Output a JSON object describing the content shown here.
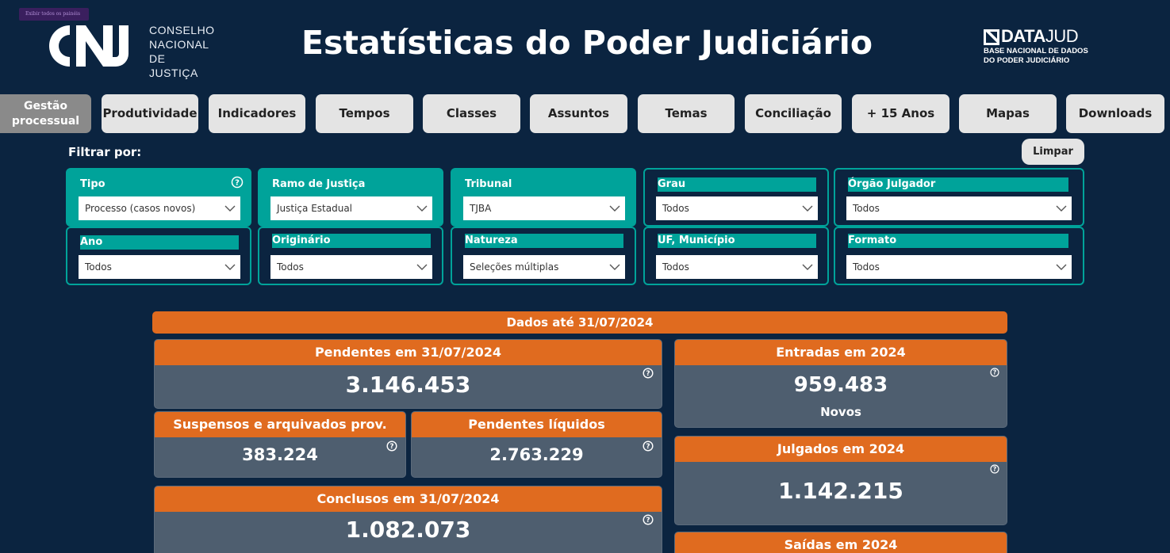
{
  "header": {
    "show_panes_label": "Exibir todos os painéis",
    "cnj_letters": "CNJ",
    "cnj_org_lines": [
      "CONSELHO",
      "NACIONAL",
      "DE JUSTIÇA"
    ],
    "title": "Estatísticas do Poder Judiciário",
    "datajud_name_bold": "DATA",
    "datajud_name_light": "JUD",
    "datajud_sub_lines": [
      "BASE NACIONAL DE DADOS",
      "DO PODER JUDICIÁRIO"
    ]
  },
  "nav": {
    "tabs": [
      {
        "label": "Gestão processual",
        "active": true
      },
      {
        "label": "Produtividade",
        "active": false
      },
      {
        "label": "Indicadores",
        "active": false
      },
      {
        "label": "Tempos",
        "active": false
      },
      {
        "label": "Classes",
        "active": false
      },
      {
        "label": "Assuntos",
        "active": false
      },
      {
        "label": "Temas",
        "active": false
      },
      {
        "label": "Conciliação",
        "active": false
      },
      {
        "label": "+ 15 Anos",
        "active": false
      },
      {
        "label": "Mapas",
        "active": false
      },
      {
        "label": "Downloads",
        "active": false
      }
    ]
  },
  "filters": {
    "heading": "Filtrar por:",
    "clear_label": "Limpar",
    "items": [
      {
        "label": "Tipo",
        "value": "Processo (casos novos)",
        "filled": true,
        "help": true
      },
      {
        "label": "Ramo de Justiça",
        "value": "Justiça Estadual",
        "filled": true,
        "help": false
      },
      {
        "label": "Tribunal",
        "value": "TJBA",
        "filled": true,
        "help": false
      },
      {
        "label": "Grau",
        "value": "Todos",
        "filled": false,
        "help": false
      },
      {
        "label": "Órgão Julgador",
        "value": "Todos",
        "filled": false,
        "help": false
      },
      {
        "label": "Ano",
        "value": "Todos",
        "filled": false,
        "help": false
      },
      {
        "label": "Originário",
        "value": "Todos",
        "filled": false,
        "help": false
      },
      {
        "label": "Natureza",
        "value": "Seleções múltiplas",
        "filled": false,
        "help": false
      },
      {
        "label": "UF, Município",
        "value": "Todos",
        "filled": false,
        "help": false
      },
      {
        "label": "Formato",
        "value": "Todos",
        "filled": false,
        "help": false
      }
    ]
  },
  "stats": {
    "date_banner": "Dados até 31/07/2024",
    "pendentes": {
      "title": "Pendentes em 31/07/2024",
      "value": "3.146.453"
    },
    "suspensos": {
      "title": "Suspensos e arquivados prov.",
      "value": "383.224"
    },
    "pendentes_liquidos": {
      "title": "Pendentes líquidos",
      "value": "2.763.229"
    },
    "conclusos": {
      "title": "Conclusos em 31/07/2024",
      "value": "1.082.073"
    },
    "entradas": {
      "title": "Entradas em 2024",
      "value": "959.483",
      "sub": "Novos"
    },
    "julgados": {
      "title": "Julgados em 2024",
      "value": "1.142.215"
    },
    "saidas": {
      "title": "Saídas em 2024"
    }
  },
  "colors": {
    "background": "#0b2440",
    "teal": "#00a39a",
    "orange": "#e06b1f",
    "card": "#4e5e6f"
  }
}
